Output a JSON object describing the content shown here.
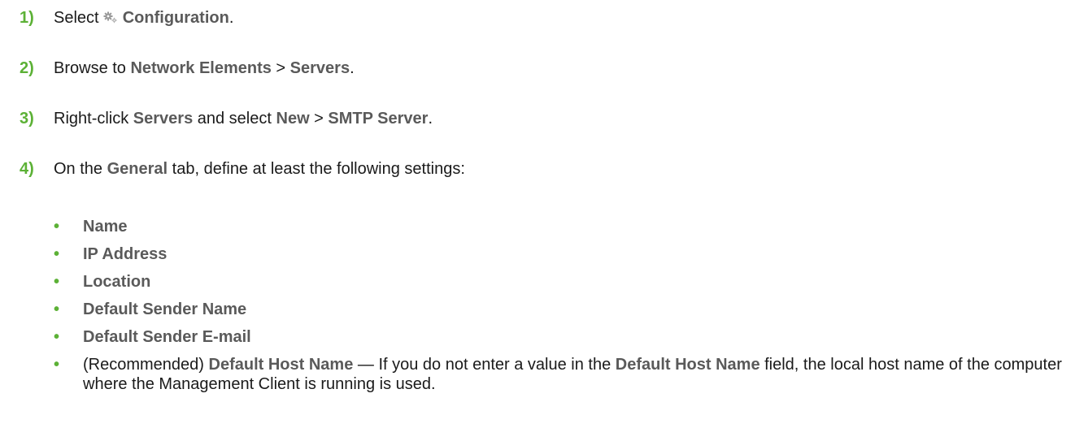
{
  "steps": [
    {
      "num": "1)",
      "t1": "Select ",
      "icon": "gear-icon",
      "b1": "Configuration",
      "t2": "."
    },
    {
      "num": "2)",
      "t1": "Browse to ",
      "b1": "Network Elements",
      "t2": " > ",
      "b2": "Servers",
      "t3": "."
    },
    {
      "num": "3)",
      "t1": "Right-click ",
      "b1": "Servers",
      "t2": " and select ",
      "b2": "New",
      "t3": " > ",
      "b3": "SMTP Server",
      "t4": "."
    },
    {
      "num": "4)",
      "t1": "On the ",
      "b1": "General",
      "t2": " tab, define at least the following settings:"
    }
  ],
  "settings": [
    "Name",
    "IP Address",
    "Location",
    "Default Sender Name",
    "Default Sender E-mail"
  ],
  "recommended": {
    "prefix": "(Recommended) ",
    "field": "Default Host Name",
    "dash": " — If you do not enter a value in the ",
    "field2": "Default Host Name",
    "rest": " field, the local host name of the computer where the Management Client is running is used."
  },
  "bullet_char": "•",
  "colors": {
    "accent": "#5cb136",
    "ui_text": "#5a5a5a",
    "body_text": "#1a1a1a"
  }
}
